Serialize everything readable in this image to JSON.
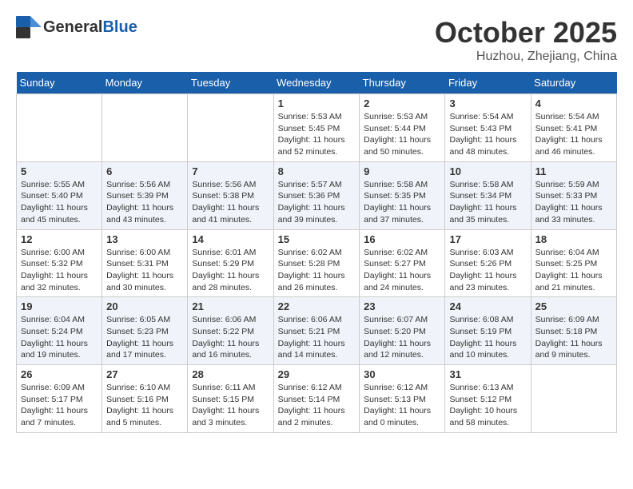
{
  "header": {
    "logo_general": "General",
    "logo_blue": "Blue",
    "month": "October 2025",
    "location": "Huzhou, Zhejiang, China"
  },
  "weekdays": [
    "Sunday",
    "Monday",
    "Tuesday",
    "Wednesday",
    "Thursday",
    "Friday",
    "Saturday"
  ],
  "weeks": [
    [
      {
        "day": "",
        "info": ""
      },
      {
        "day": "",
        "info": ""
      },
      {
        "day": "",
        "info": ""
      },
      {
        "day": "1",
        "info": "Sunrise: 5:53 AM\nSunset: 5:45 PM\nDaylight: 11 hours\nand 52 minutes."
      },
      {
        "day": "2",
        "info": "Sunrise: 5:53 AM\nSunset: 5:44 PM\nDaylight: 11 hours\nand 50 minutes."
      },
      {
        "day": "3",
        "info": "Sunrise: 5:54 AM\nSunset: 5:43 PM\nDaylight: 11 hours\nand 48 minutes."
      },
      {
        "day": "4",
        "info": "Sunrise: 5:54 AM\nSunset: 5:41 PM\nDaylight: 11 hours\nand 46 minutes."
      }
    ],
    [
      {
        "day": "5",
        "info": "Sunrise: 5:55 AM\nSunset: 5:40 PM\nDaylight: 11 hours\nand 45 minutes."
      },
      {
        "day": "6",
        "info": "Sunrise: 5:56 AM\nSunset: 5:39 PM\nDaylight: 11 hours\nand 43 minutes."
      },
      {
        "day": "7",
        "info": "Sunrise: 5:56 AM\nSunset: 5:38 PM\nDaylight: 11 hours\nand 41 minutes."
      },
      {
        "day": "8",
        "info": "Sunrise: 5:57 AM\nSunset: 5:36 PM\nDaylight: 11 hours\nand 39 minutes."
      },
      {
        "day": "9",
        "info": "Sunrise: 5:58 AM\nSunset: 5:35 PM\nDaylight: 11 hours\nand 37 minutes."
      },
      {
        "day": "10",
        "info": "Sunrise: 5:58 AM\nSunset: 5:34 PM\nDaylight: 11 hours\nand 35 minutes."
      },
      {
        "day": "11",
        "info": "Sunrise: 5:59 AM\nSunset: 5:33 PM\nDaylight: 11 hours\nand 33 minutes."
      }
    ],
    [
      {
        "day": "12",
        "info": "Sunrise: 6:00 AM\nSunset: 5:32 PM\nDaylight: 11 hours\nand 32 minutes."
      },
      {
        "day": "13",
        "info": "Sunrise: 6:00 AM\nSunset: 5:31 PM\nDaylight: 11 hours\nand 30 minutes."
      },
      {
        "day": "14",
        "info": "Sunrise: 6:01 AM\nSunset: 5:29 PM\nDaylight: 11 hours\nand 28 minutes."
      },
      {
        "day": "15",
        "info": "Sunrise: 6:02 AM\nSunset: 5:28 PM\nDaylight: 11 hours\nand 26 minutes."
      },
      {
        "day": "16",
        "info": "Sunrise: 6:02 AM\nSunset: 5:27 PM\nDaylight: 11 hours\nand 24 minutes."
      },
      {
        "day": "17",
        "info": "Sunrise: 6:03 AM\nSunset: 5:26 PM\nDaylight: 11 hours\nand 23 minutes."
      },
      {
        "day": "18",
        "info": "Sunrise: 6:04 AM\nSunset: 5:25 PM\nDaylight: 11 hours\nand 21 minutes."
      }
    ],
    [
      {
        "day": "19",
        "info": "Sunrise: 6:04 AM\nSunset: 5:24 PM\nDaylight: 11 hours\nand 19 minutes."
      },
      {
        "day": "20",
        "info": "Sunrise: 6:05 AM\nSunset: 5:23 PM\nDaylight: 11 hours\nand 17 minutes."
      },
      {
        "day": "21",
        "info": "Sunrise: 6:06 AM\nSunset: 5:22 PM\nDaylight: 11 hours\nand 16 minutes."
      },
      {
        "day": "22",
        "info": "Sunrise: 6:06 AM\nSunset: 5:21 PM\nDaylight: 11 hours\nand 14 minutes."
      },
      {
        "day": "23",
        "info": "Sunrise: 6:07 AM\nSunset: 5:20 PM\nDaylight: 11 hours\nand 12 minutes."
      },
      {
        "day": "24",
        "info": "Sunrise: 6:08 AM\nSunset: 5:19 PM\nDaylight: 11 hours\nand 10 minutes."
      },
      {
        "day": "25",
        "info": "Sunrise: 6:09 AM\nSunset: 5:18 PM\nDaylight: 11 hours\nand 9 minutes."
      }
    ],
    [
      {
        "day": "26",
        "info": "Sunrise: 6:09 AM\nSunset: 5:17 PM\nDaylight: 11 hours\nand 7 minutes."
      },
      {
        "day": "27",
        "info": "Sunrise: 6:10 AM\nSunset: 5:16 PM\nDaylight: 11 hours\nand 5 minutes."
      },
      {
        "day": "28",
        "info": "Sunrise: 6:11 AM\nSunset: 5:15 PM\nDaylight: 11 hours\nand 3 minutes."
      },
      {
        "day": "29",
        "info": "Sunrise: 6:12 AM\nSunset: 5:14 PM\nDaylight: 11 hours\nand 2 minutes."
      },
      {
        "day": "30",
        "info": "Sunrise: 6:12 AM\nSunset: 5:13 PM\nDaylight: 11 hours\nand 0 minutes."
      },
      {
        "day": "31",
        "info": "Sunrise: 6:13 AM\nSunset: 5:12 PM\nDaylight: 10 hours\nand 58 minutes."
      },
      {
        "day": "",
        "info": ""
      }
    ]
  ]
}
